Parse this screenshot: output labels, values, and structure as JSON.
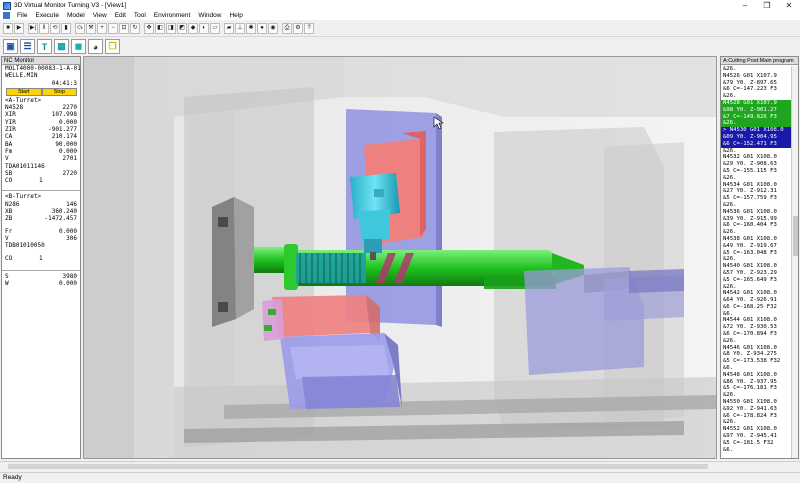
{
  "window": {
    "title": "3D Virtual Monitor Turning V3 - [View1]",
    "minimize": "–",
    "restore": "❐",
    "close": "✕"
  },
  "menu": [
    "File",
    "Execute",
    "Model",
    "View",
    "Edit",
    "Tool",
    "Environment",
    "Window",
    "Help"
  ],
  "nc_monitor": {
    "title": "NC Monitor",
    "program": "MOLT4000-00083-1-A-01",
    "part": "WELLE.MIN",
    "time": "04:41:3",
    "start_label": "Start",
    "stop_label": "Stop",
    "a_turret_label": "<A-Turret>",
    "a_rows": [
      {
        "k": "N4528",
        "v": "2270"
      },
      {
        "k": "XIR",
        "v": "107.998"
      },
      {
        "k": "YIR",
        "v": "0.000"
      },
      {
        "k": "ZIR",
        "v": "-901.277"
      },
      {
        "k": "CA",
        "v": "210.174"
      },
      {
        "k": "BA",
        "v": "90.000"
      },
      {
        "k": "Fm",
        "v": "0.000"
      },
      {
        "k": "V",
        "v": "2701"
      }
    ],
    "a_tool": "TDA01011146",
    "a_sb": {
      "k": "SB",
      "v": "2720"
    },
    "a_co": {
      "k": "CO",
      "v": "1"
    },
    "b_turret_label": "<B-Turret>",
    "b_rows": [
      {
        "k": "N286",
        "v": "146"
      },
      {
        "k": "XB",
        "v": "360.240"
      },
      {
        "k": "ZB",
        "v": "-1472.457"
      }
    ],
    "b_rows2": [
      {
        "k": "Fr",
        "v": "0.000"
      },
      {
        "k": "V",
        "v": "306"
      }
    ],
    "b_tool": "TDB01010050",
    "b_co": {
      "k": "CO",
      "v": "1"
    },
    "s_row": {
      "k": "S",
      "v": "3980"
    },
    "w_row": {
      "k": "W",
      "v": "0.000"
    }
  },
  "program_panel": {
    "title": "A:Cutting Post:Main program",
    "lines": [
      {
        "t": "&26.",
        "s": ""
      },
      {
        "t": "N4526 G01 X107.9",
        "s": ""
      },
      {
        "t": "&79 Y0. Z-897.65",
        "s": ""
      },
      {
        "t": "&6 C=-147.223 F3",
        "s": ""
      },
      {
        "t": "&26.",
        "s": ""
      },
      {
        "t": "N4528 G01 X107.9",
        "s": "green"
      },
      {
        "t": "&98 Y0. Z-901.27",
        "s": "green"
      },
      {
        "t": "&7 C=-149.826 F3",
        "s": "green"
      },
      {
        "t": "&26.",
        "s": "green"
      },
      {
        "t": "> N4530 G01 X108.0",
        "s": "blue"
      },
      {
        "t": "&09 Y0. Z-904.95",
        "s": "blue"
      },
      {
        "t": "&6 C=-152.471 F3",
        "s": "blue"
      },
      {
        "t": "&26.",
        "s": ""
      },
      {
        "t": "N4532 G01 X108.0",
        "s": ""
      },
      {
        "t": "&29 Y0. Z-908.63",
        "s": ""
      },
      {
        "t": "&5 C=-155.115 F3",
        "s": ""
      },
      {
        "t": "&26.",
        "s": ""
      },
      {
        "t": "N4534 G01 X108.0",
        "s": ""
      },
      {
        "t": "&27 Y0. Z-912.31",
        "s": ""
      },
      {
        "t": "&5 C=-157.759 F3",
        "s": ""
      },
      {
        "t": "&26.",
        "s": ""
      },
      {
        "t": "N4536 G01 X108.0",
        "s": ""
      },
      {
        "t": "&39 Y0. Z-915.99",
        "s": ""
      },
      {
        "t": "&6 C=-160.404 F3",
        "s": ""
      },
      {
        "t": "&26.",
        "s": ""
      },
      {
        "t": "N4538 G01 X108.0",
        "s": ""
      },
      {
        "t": "&49 Y0. Z-919.67",
        "s": ""
      },
      {
        "t": "&5 C=-163.048 F3",
        "s": ""
      },
      {
        "t": "&26.",
        "s": ""
      },
      {
        "t": "N4540 G01 X108.0",
        "s": ""
      },
      {
        "t": "&57 Y0. Z-923.29",
        "s": ""
      },
      {
        "t": "&5 C=-165.649 F3",
        "s": ""
      },
      {
        "t": "&26.",
        "s": ""
      },
      {
        "t": "N4542 G01 X108.0",
        "s": ""
      },
      {
        "t": "&64 Y0. Z-926.91",
        "s": ""
      },
      {
        "t": "&6 C=-168.25 F32",
        "s": ""
      },
      {
        "t": "&6.",
        "s": ""
      },
      {
        "t": "N4544 G01 X108.0",
        "s": ""
      },
      {
        "t": "&72 Y0. Z-930.53",
        "s": ""
      },
      {
        "t": "&6 C=-170.894 F3",
        "s": ""
      },
      {
        "t": "&26.",
        "s": ""
      },
      {
        "t": "N4546 G01 X108.0",
        "s": ""
      },
      {
        "t": "&8 Y0. Z-934.275",
        "s": ""
      },
      {
        "t": "&5 C=-173.538 F32",
        "s": ""
      },
      {
        "t": "&6.",
        "s": ""
      },
      {
        "t": "N4548 G01 X108.0",
        "s": ""
      },
      {
        "t": "&86 Y0. Z-937.95",
        "s": ""
      },
      {
        "t": "&5 C=-176.181 F3",
        "s": ""
      },
      {
        "t": "&26.",
        "s": ""
      },
      {
        "t": "N4550 G01 X108.0",
        "s": ""
      },
      {
        "t": "&92 Y0. Z-941.63",
        "s": ""
      },
      {
        "t": "&6 C=-178.824 F3",
        "s": ""
      },
      {
        "t": "&26.",
        "s": ""
      },
      {
        "t": "N4552 G01 X108.0",
        "s": ""
      },
      {
        "t": "&97 Y0. Z-945.41",
        "s": ""
      },
      {
        "t": "&5 C=-181.5 F32",
        "s": ""
      },
      {
        "t": "&6.",
        "s": ""
      }
    ]
  },
  "toolbar1": [
    {
      "name": "stop-icon",
      "g": "■"
    },
    {
      "name": "play-icon",
      "g": "▶"
    },
    {
      "name": "step-icon",
      "g": "▶|"
    },
    {
      "name": "pause-icon",
      "g": "‖"
    },
    {
      "name": "reset-icon",
      "g": "⟲"
    },
    {
      "name": "single-block-icon",
      "g": "▮"
    },
    {
      "name": "skip-icon",
      "g": "⤼"
    },
    {
      "name": "tool-icon",
      "g": "⚒"
    },
    {
      "name": "zoom-in-icon",
      "g": "+"
    },
    {
      "name": "zoom-out-icon",
      "g": "−"
    },
    {
      "name": "zoom-fit-icon",
      "g": "⊡"
    },
    {
      "name": "rotate-icon",
      "g": "↻"
    },
    {
      "name": "pan-icon",
      "g": "✥"
    },
    {
      "name": "view-front-icon",
      "g": "◧"
    },
    {
      "name": "view-top-icon",
      "g": "◨"
    },
    {
      "name": "view-side-icon",
      "g": "◩"
    },
    {
      "name": "view-iso-icon",
      "g": "◆"
    },
    {
      "name": "section-icon",
      "g": "◐"
    },
    {
      "name": "wire-icon",
      "g": "▱"
    },
    {
      "name": "shade-icon",
      "g": "▰"
    },
    {
      "name": "measure-icon",
      "g": "⊥"
    },
    {
      "name": "collision-icon",
      "g": "✱"
    },
    {
      "name": "record-icon",
      "g": "●"
    },
    {
      "name": "camera-icon",
      "g": "◉"
    },
    {
      "name": "print-icon",
      "g": "⎙"
    },
    {
      "name": "settings-icon",
      "g": "⚙"
    },
    {
      "name": "help-icon",
      "g": "?"
    }
  ],
  "toolbar2": [
    {
      "name": "nc-monitor-icon",
      "g": "▣",
      "c": "#1f4fa8"
    },
    {
      "name": "list-icon",
      "g": "☰",
      "c": "#1f4fa8"
    },
    {
      "name": "tool-holder-icon",
      "g": "T",
      "c": "#138a8a"
    },
    {
      "name": "model-icon",
      "g": "▩",
      "c": "#1aa3a3"
    },
    {
      "name": "solid-icon",
      "g": "◼",
      "c": "#19b0b0"
    },
    {
      "name": "workpiece-icon",
      "g": "◕",
      "c": "#333333"
    },
    {
      "name": "layers-icon",
      "g": "❐",
      "c": "#d2b400"
    }
  ],
  "status": {
    "text": "Ready"
  }
}
